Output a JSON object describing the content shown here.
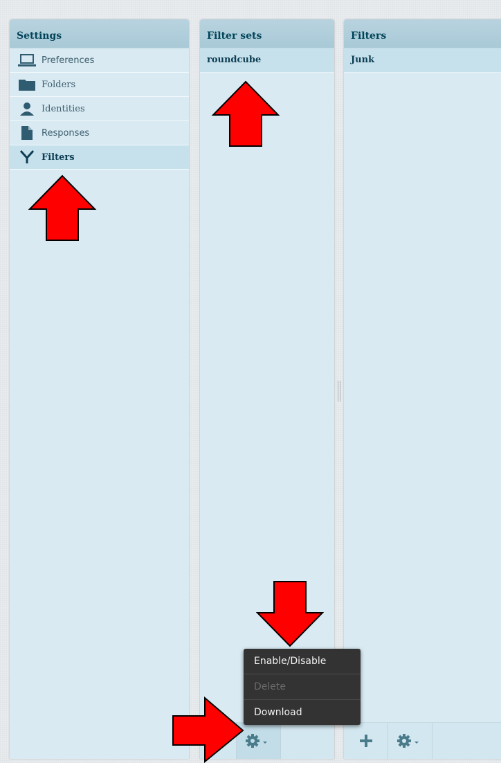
{
  "settings_panel": {
    "title": "Settings",
    "items": [
      {
        "label": "Preferences",
        "icon": "laptop-icon"
      },
      {
        "label": "Folders",
        "icon": "folder-icon"
      },
      {
        "label": "Identities",
        "icon": "person-icon"
      },
      {
        "label": "Responses",
        "icon": "document-icon"
      },
      {
        "label": "Filters",
        "icon": "filter-icon",
        "selected": true
      }
    ]
  },
  "filter_sets_panel": {
    "title": "Filter sets",
    "items": [
      "roundcube"
    ],
    "footer": {
      "add_icon": "plus-icon",
      "actions_icon": "gear-dropdown-icon"
    }
  },
  "filters_panel": {
    "title": "Filters",
    "items": [
      "Junk"
    ],
    "footer": {
      "add_icon": "plus-icon",
      "actions_icon": "gear-dropdown-icon"
    }
  },
  "actions_menu": {
    "items": [
      {
        "label": "Enable/Disable",
        "enabled": true
      },
      {
        "label": "Delete",
        "enabled": false
      },
      {
        "label": "Download",
        "enabled": true
      }
    ]
  },
  "colors": {
    "panel_bg": "#d9eaf3",
    "header_bg": "#b1cedb",
    "header_text": "#004458",
    "selected_bg": "#c7e1ec",
    "menu_bg": "#333333",
    "annotation_arrow": "#ff0000"
  }
}
